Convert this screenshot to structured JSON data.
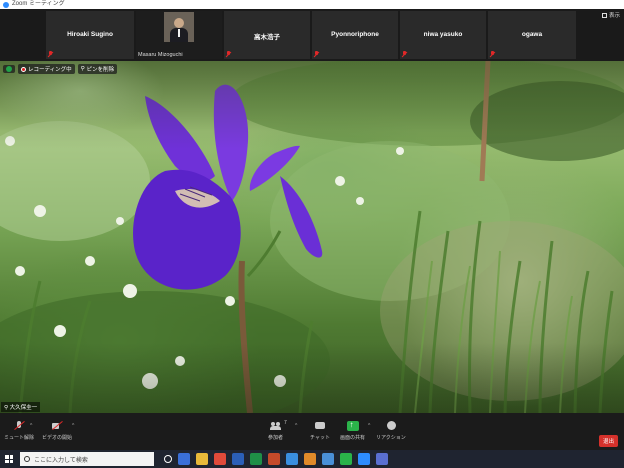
{
  "window": {
    "title": "Zoom ミーティング"
  },
  "strip": {
    "view_label": "表示",
    "participants": [
      {
        "name": "Hiroaki Sugino",
        "muted": true
      },
      {
        "name": "Masaru Mizoguchi",
        "muted": false,
        "has_video": true
      },
      {
        "name": "高木浩子",
        "muted": true
      },
      {
        "name": "Pyonnoriphone",
        "muted": true
      },
      {
        "name": "niwa yasuko",
        "muted": true
      },
      {
        "name": "ogawa",
        "muted": true
      }
    ]
  },
  "main_video": {
    "recording_label": "レコーディング中",
    "pin_label": "ピンを削除",
    "speaker_name": "大久保圭一"
  },
  "toolbar": {
    "mute_label": "ミュート解除",
    "video_label": "ビデオの開始",
    "participants_label": "参加者",
    "participants_count": "7",
    "chat_label": "チャット",
    "share_label": "画面の共有",
    "reactions_label": "リアクション",
    "leave_label": "退出"
  },
  "taskbar": {
    "search_placeholder": "ここに入力して検索"
  },
  "colors": {
    "leave_red": "#d5312b",
    "share_green": "#2bb34a",
    "muted_red": "#e02828",
    "iris_purple": "#6a2fd6"
  }
}
